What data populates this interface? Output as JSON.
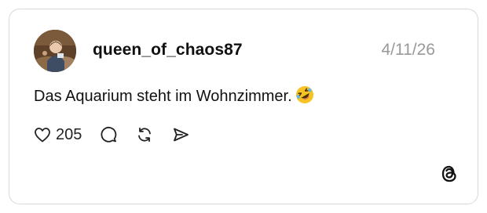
{
  "post": {
    "username": "queen_of_chaos87",
    "date": "4/11/26",
    "text": "Das Aquarium steht im Wohnzimmer.",
    "emoji": "rolling-on-floor-laughing-emoji",
    "likes": "205"
  },
  "icons": {
    "like": "heart-icon",
    "reply": "speech-bubble-icon",
    "repost": "repost-icon",
    "share": "send-icon",
    "brand": "threads-logo-icon"
  },
  "colors": {
    "border": "#d9d9d9",
    "date": "#999999",
    "text": "#111111",
    "emoji_face": "#f7c324"
  }
}
